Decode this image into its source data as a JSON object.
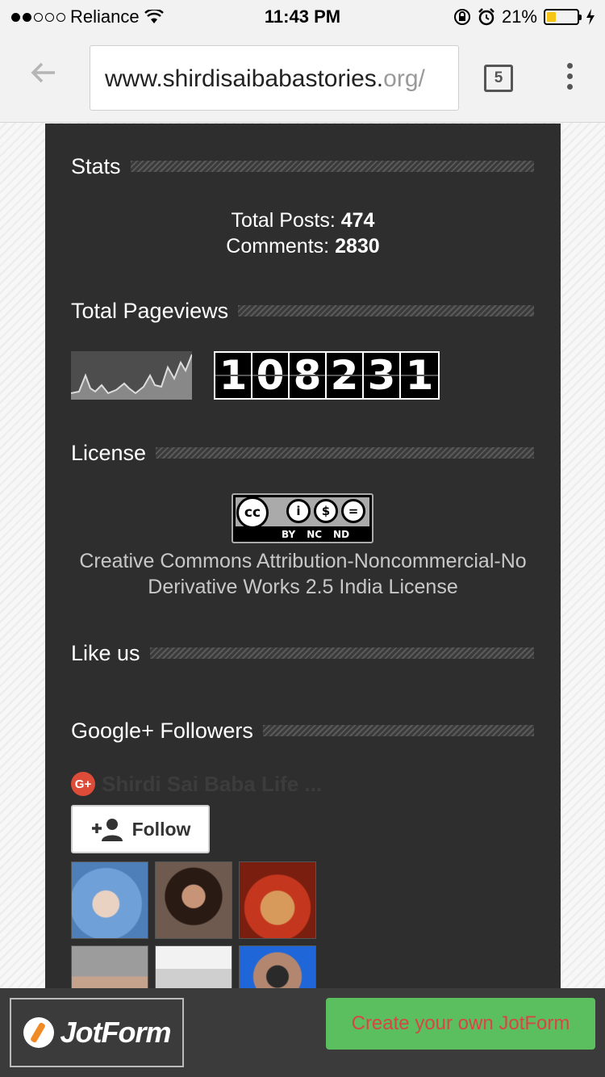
{
  "status_bar": {
    "carrier": "Reliance",
    "time": "11:43 PM",
    "battery": "21%",
    "battery_level": 0.21
  },
  "browser": {
    "url_main": "www.shirdisaibabastories.",
    "url_tail": "org/",
    "tab_count": "5"
  },
  "sections": {
    "stats_title": "Stats",
    "total_posts_label": "Total Posts:",
    "total_posts_value": "474",
    "comments_label": "Comments:",
    "comments_value": "2830",
    "pageviews_title": "Total Pageviews",
    "pageviews_digits": [
      "1",
      "0",
      "8",
      "2",
      "3",
      "1"
    ],
    "license_title": "License",
    "license_badge_labels": [
      "BY",
      "NC",
      "ND"
    ],
    "license_text": "Creative Commons Attribution-Noncommercial-No Derivative Works 2.5 India License",
    "like_title": "Like us",
    "gplus_title": "Google+ Followers"
  },
  "gplus": {
    "icon_text": "G+",
    "page_name": "Shirdi Sai Baba Life ...",
    "follow_label": "Follow"
  },
  "jotform": {
    "logo_text": "JotForm",
    "cta": "Create your own JotForm"
  }
}
